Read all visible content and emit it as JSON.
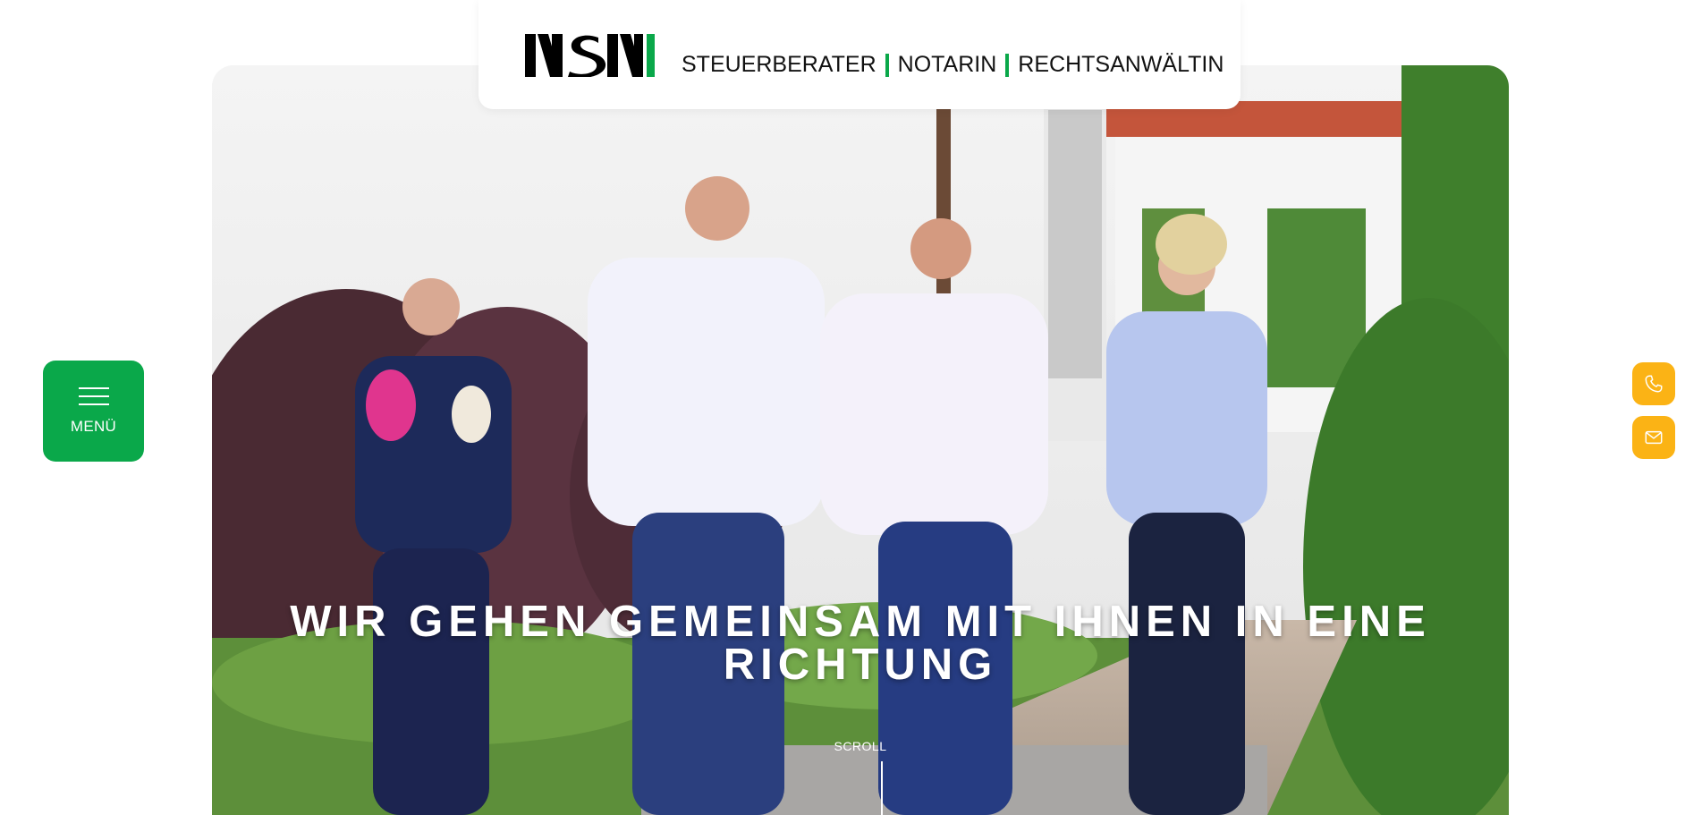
{
  "brand": {
    "logo_text": "NSN",
    "accent_color": "#0aa84a",
    "contact_color": "#fbb315"
  },
  "nav": {
    "items": [
      {
        "label": "STEUERBERATER"
      },
      {
        "label": "NOTARIN"
      },
      {
        "label": "RECHTSANWÄLTIN"
      }
    ]
  },
  "menu": {
    "label": "MENÜ",
    "icon": "hamburger-icon"
  },
  "hero": {
    "headline": "WIR GEHEN GEMEINSAM MIT IHNEN IN EINE RICHTUNG",
    "scroll_label": "SCROLL"
  },
  "contact": {
    "phone_icon": "phone-icon",
    "mail_icon": "mail-icon"
  }
}
